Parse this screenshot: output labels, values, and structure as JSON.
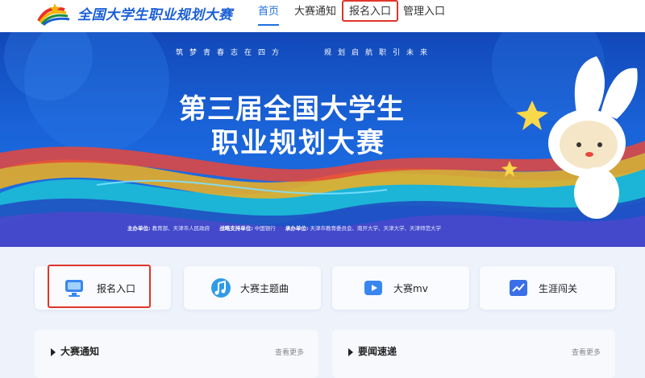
{
  "header": {
    "brand": "全国大学生职业规划大赛",
    "logo_icon": "rainbow-star-logo-icon",
    "nav": {
      "home": "首页",
      "notice": "大赛通知",
      "signup": "报名入口",
      "manage": "管理入口"
    },
    "highlight_color": "#e0342a",
    "accent_color": "#1e6fe0"
  },
  "banner": {
    "slogan_left": "筑梦青春志在四方",
    "slogan_right": "规划启航职引未来",
    "title_line1": "第三届全国大学生",
    "title_line2": "职业规划大赛",
    "credits": [
      {
        "label": "主办单位:",
        "value": "教育部、天津市人民政府"
      },
      {
        "label": "战略支持单位:",
        "value": "中国银行"
      },
      {
        "label": "承办单位:",
        "value": "天津市教育委员会、南开大学、天津大学、天津师范大学"
      }
    ]
  },
  "quick_links": [
    {
      "label": "报名入口",
      "icon": "monitor-icon"
    },
    {
      "label": "大赛主题曲",
      "icon": "music-note-icon"
    },
    {
      "label": "大赛mv",
      "icon": "video-play-icon"
    },
    {
      "label": "生涯闯关",
      "icon": "chart-card-icon"
    }
  ],
  "sections": [
    {
      "title": "大赛通知",
      "more": "查看更多"
    },
    {
      "title": "要闻速递",
      "more": "查看更多"
    }
  ]
}
